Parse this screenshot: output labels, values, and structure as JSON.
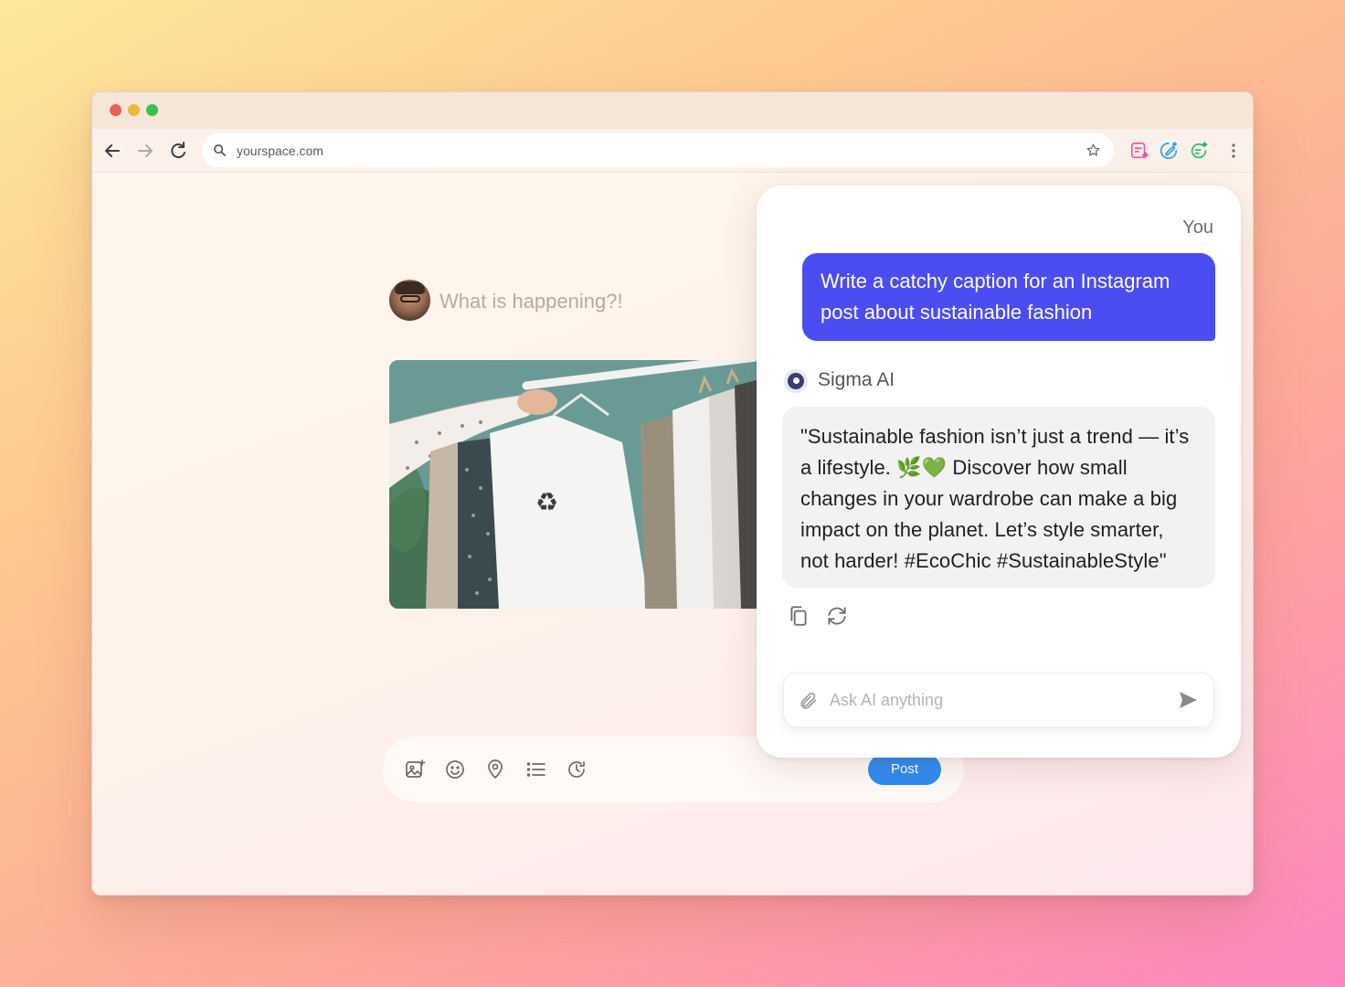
{
  "browser": {
    "url": "yourspace.com",
    "extensions": [
      "note-sparkle-icon",
      "edit-sparkle-icon",
      "chat-sparkle-icon"
    ]
  },
  "composer": {
    "prompt_placeholder": "What is happening?!",
    "toolbar_icons": [
      "image-icon",
      "emoji-icon",
      "location-icon",
      "list-icon",
      "schedule-icon"
    ],
    "post_label": "Post"
  },
  "ai_panel": {
    "you_label": "You",
    "user_message": "Write a catchy caption for an Instagram post about sustainable fashion",
    "assistant_name": "Sigma AI",
    "assistant_message": "\"Sustainable fashion isn’t just a trend — it’s a lifestyle. 🌿💚  Discover how small changes in your wardrobe can make a big impact on the planet. Let’s style smarter, not harder! #EcoChic #SustainableStyle\"",
    "input_placeholder": "Ask AI anything"
  },
  "colors": {
    "user_bubble": "#4b4df2",
    "post_button": "#2f8cf0"
  }
}
